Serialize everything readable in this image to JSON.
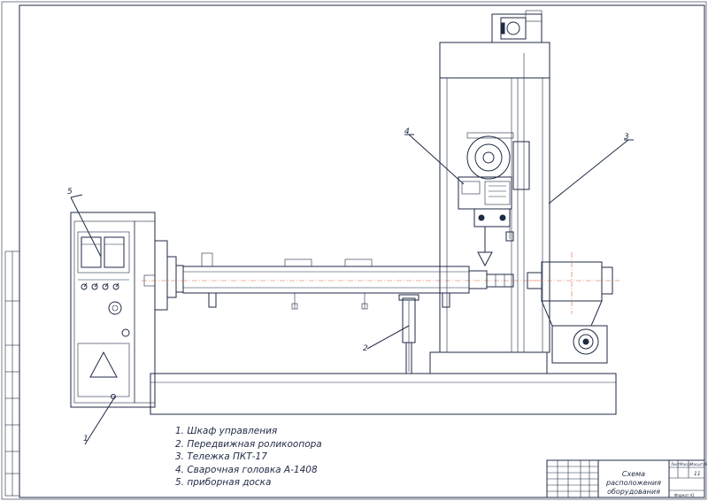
{
  "drawing": {
    "callouts": [
      "1",
      "2",
      "3",
      "4",
      "5"
    ],
    "legend": [
      "1. Шкаф управления",
      "2. Передвижная роликоопора",
      "3. Тележка ПКТ-17",
      "4. Сварочная головка А-1408",
      "5. приборная доска"
    ]
  },
  "title_block": {
    "title": "Схема расположения оборудования",
    "sheet_count": "11",
    "header_cells": [
      "Лист",
      "Масса",
      "Масштаб"
    ],
    "format": "Формат А1"
  },
  "colors": {
    "ink": "#1f2a44",
    "axis_line": "#d9653b",
    "paper": "#ffffff"
  }
}
